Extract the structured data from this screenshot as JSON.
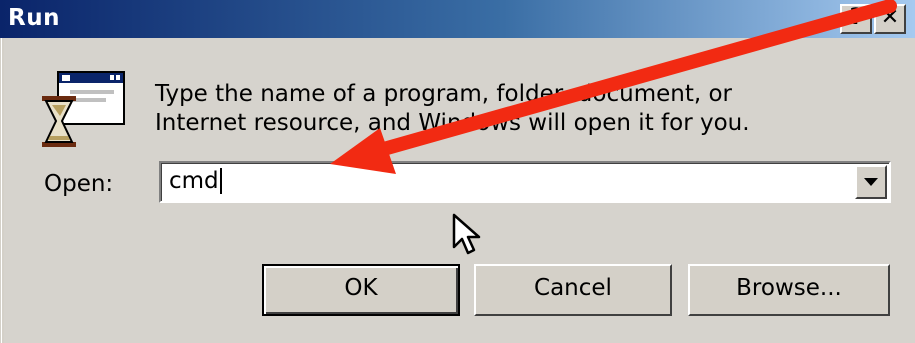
{
  "window": {
    "title": "Run",
    "help_glyph": "?",
    "close_glyph": "✕"
  },
  "icon": {
    "name": "run-program-hourglass-icon"
  },
  "prompt": {
    "line1": "Type the name of a program, folder, document, or",
    "line2": "Internet resource, and Windows will open it for you."
  },
  "open": {
    "label": "Open:",
    "value": "cmd"
  },
  "buttons": {
    "ok": "OK",
    "cancel": "Cancel",
    "browse": "Browse..."
  },
  "annotation": {
    "color": "#f22a12"
  },
  "colors": {
    "titlebar_start": "#0a246a",
    "titlebar_end": "#a6caf0",
    "dialog_bg": "#d6d3cd"
  }
}
